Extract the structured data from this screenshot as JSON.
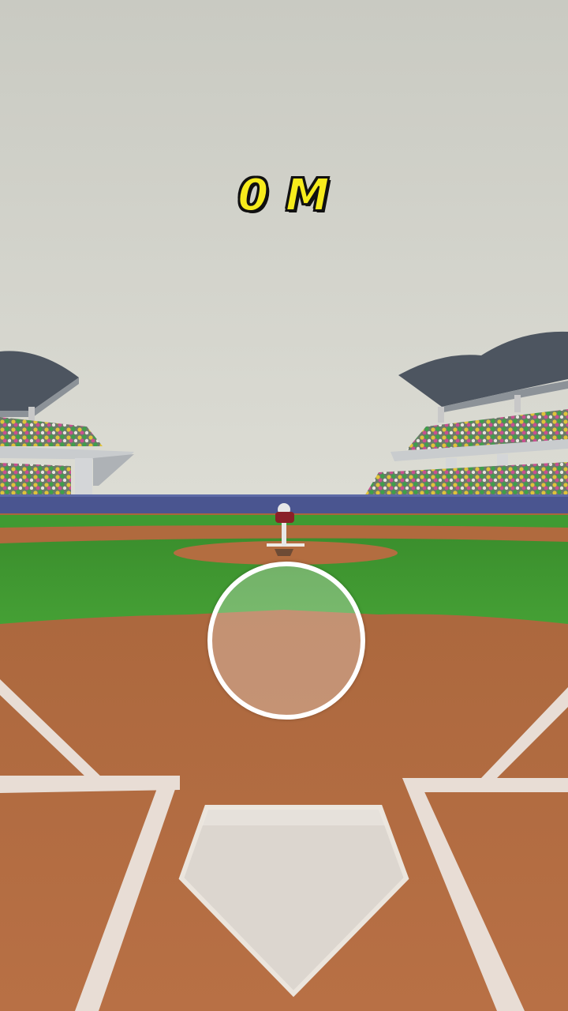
{
  "hud": {
    "distance_value": "0",
    "distance_unit": "M",
    "distance_text": "0 M"
  },
  "scene": {
    "sky_color": "#cfd0c8",
    "wall_color": "#4a5590",
    "grass_color": "#3f9a32",
    "dirt_color": "#b06a3e",
    "chalk_color": "#e8ddd5"
  },
  "controls": {
    "aim_circle_icon": "aim-reticle-icon"
  }
}
